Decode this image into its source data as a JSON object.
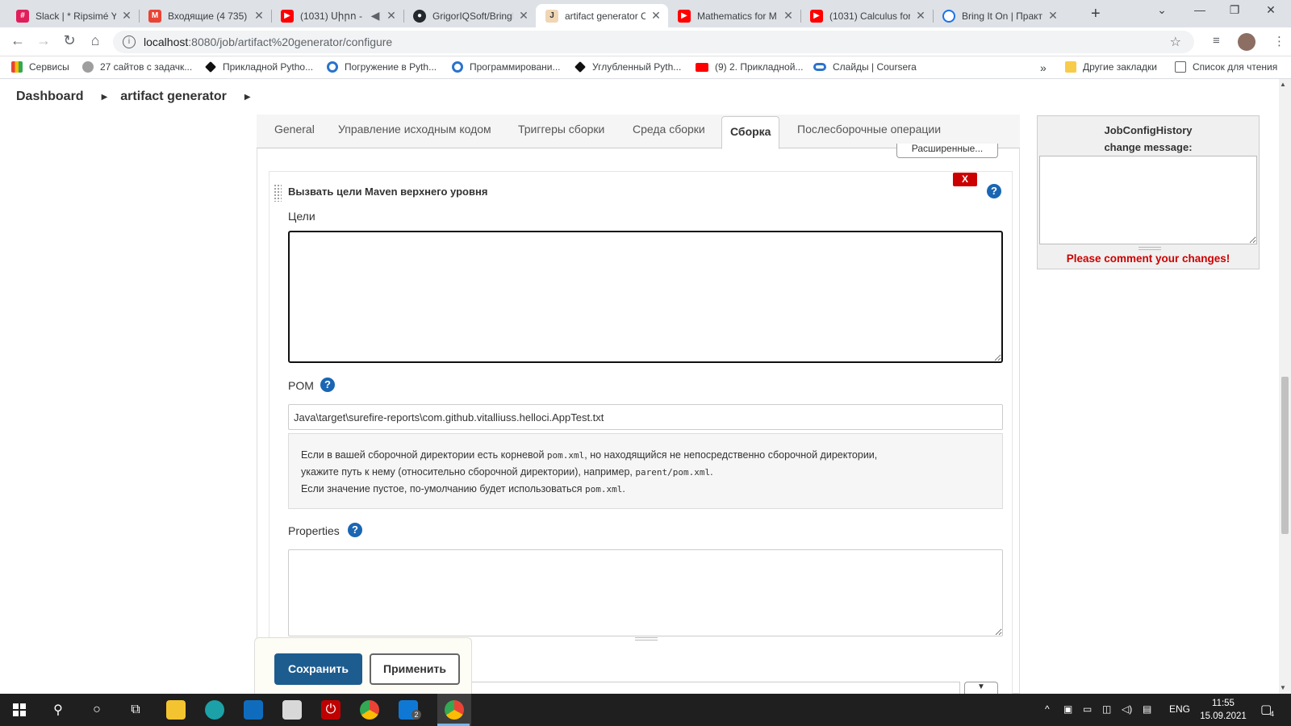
{
  "browser": {
    "tabs": [
      {
        "title": "Slack | * Ripsimé Ye",
        "favicon": "slack-icon",
        "color": "#e01e5a"
      },
      {
        "title": "Входящие (4 735) -",
        "favicon": "gmail-icon",
        "color": "#ea4335"
      },
      {
        "title": "(1031) Սիրո -",
        "favicon": "youtube-icon",
        "color": "#ff0000",
        "muted": "🔇"
      },
      {
        "title": "GrigorIQSoft/BringI",
        "favicon": "github-icon",
        "color": "#24292e"
      },
      {
        "title": "artifact generator C",
        "favicon": "jenkins-icon",
        "color": "#d24939",
        "active": true
      },
      {
        "title": "Mathematics for M",
        "favicon": "youtube-icon",
        "color": "#ff0000"
      },
      {
        "title": "(1031) Calculus for",
        "favicon": "youtube-icon",
        "color": "#ff0000"
      },
      {
        "title": "Bring It On | Практ",
        "favicon": "globe-icon",
        "color": "#1a73e8"
      }
    ],
    "new_tab": "+",
    "url_host": "localhost",
    "url_path": ":8080/job/artifact%20generator/configure",
    "bookmarks": [
      {
        "label": "Сервисы",
        "icon": "apps-grid-icon"
      },
      {
        "label": "27 сайтов с задачк...",
        "icon": "globe-icon"
      },
      {
        "label": "Прикладной Pytho...",
        "icon": "diamond-icon"
      },
      {
        "label": "Погружение в Pyth...",
        "icon": "coursera-icon"
      },
      {
        "label": "Программировани...",
        "icon": "coursera-icon"
      },
      {
        "label": "Углубленный Pyth...",
        "icon": "diamond-icon"
      },
      {
        "label": "(9) 2. Прикладной...",
        "icon": "youtube-icon"
      },
      {
        "label": "Слайды | Coursera",
        "icon": "link-icon"
      }
    ],
    "bookmarks_more": "»",
    "other_bookmarks": "Другие закладки",
    "reading_list": "Список для чтения"
  },
  "jenkins": {
    "breadcrumb": [
      "Dashboard",
      "artifact generator"
    ],
    "tabs": [
      "General",
      "Управление исходным кодом",
      "Триггеры сборки",
      "Среда сборки",
      "Сборка",
      "Послесборочные операции"
    ],
    "active_tab": "Сборка",
    "advanced_button": "Расширенные...",
    "section": {
      "title": "Вызвать цели Maven верхнего уровня",
      "delete_label": "X",
      "goals_label": "Цели",
      "goals_value": "",
      "pom_label": "POM",
      "pom_value": "Java\\target\\surefire-reports\\com.github.vitalliuss.helloci.AppTest.txt",
      "help_line1_a": "Если в вашей сборочной директории есть корневой ",
      "help_line1_code": "pom.xml",
      "help_line1_b": ", но находящийся не непосредственно сборочной директории,",
      "help_line2_a": "укажите путь к нему (относительно сборочной директории), например, ",
      "help_line2_code": "parent/pom.xml",
      "help_line2_b": ".",
      "help_line3_a": "Если значение пустое, по-умолчанию будет использоваться ",
      "help_line3_code": "pom.xml",
      "help_line3_b": ".",
      "properties_label": "Properties",
      "help_symbol": "?"
    },
    "save_button": "Сохранить",
    "apply_button": "Применить",
    "side_panel": {
      "title_line1": "JobConfigHistory",
      "title_line2": "change message:",
      "warning": "Please comment your changes!"
    }
  },
  "taskbar": {
    "language": "ENG",
    "time": "11:55",
    "date": "15.09.2021",
    "notifications": "4",
    "mail_badge": "2"
  },
  "colors": {
    "save_button": "#1d5c8f",
    "delete_button": "#cc0000",
    "help_icon": "#1a66b3",
    "warning_text": "#cc0000"
  }
}
